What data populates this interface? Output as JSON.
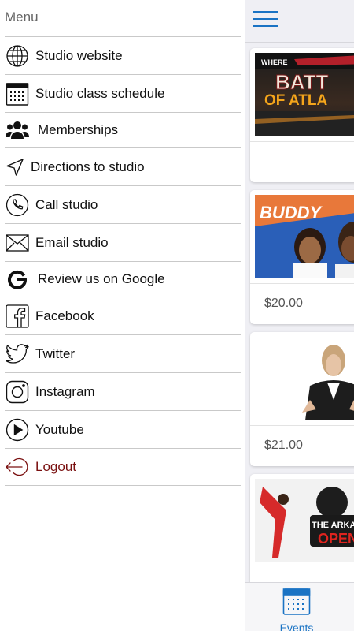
{
  "menu": {
    "header": "Menu",
    "items": [
      {
        "label": "Studio website",
        "icon": "globe-icon"
      },
      {
        "label": "Studio class schedule",
        "icon": "calendar-icon"
      },
      {
        "label": "Memberships",
        "icon": "users-icon"
      },
      {
        "label": "Directions to studio",
        "icon": "navigation-arrow-icon"
      },
      {
        "label": "Call studio",
        "icon": "phone-icon"
      },
      {
        "label": "Email studio",
        "icon": "envelope-icon"
      },
      {
        "label": "Review us on Google",
        "icon": "google-icon"
      },
      {
        "label": "Facebook",
        "icon": "facebook-icon"
      },
      {
        "label": "Twitter",
        "icon": "twitter-icon"
      },
      {
        "label": "Instagram",
        "icon": "instagram-icon"
      },
      {
        "label": "Youtube",
        "icon": "youtube-icon"
      },
      {
        "label": "Logout",
        "icon": "logout-icon"
      }
    ]
  },
  "main": {
    "cards": [
      {
        "banner_lines": [
          "WHERE",
          "BATT",
          "OF ATLA"
        ],
        "price": ""
      },
      {
        "banner_lines": [
          "BUDDY"
        ],
        "price": "$20.00"
      },
      {
        "banner_lines": [],
        "price": "$21.00"
      },
      {
        "banner_lines": [
          "THE ARKAN",
          "OPEN"
        ],
        "price": ""
      }
    ],
    "tab_bar": {
      "events_label": "Events"
    }
  },
  "colors": {
    "accent": "#1a73c4",
    "logout": "#7a1010",
    "divider": "#c9c9c9",
    "panel_bg": "#efeff4"
  }
}
